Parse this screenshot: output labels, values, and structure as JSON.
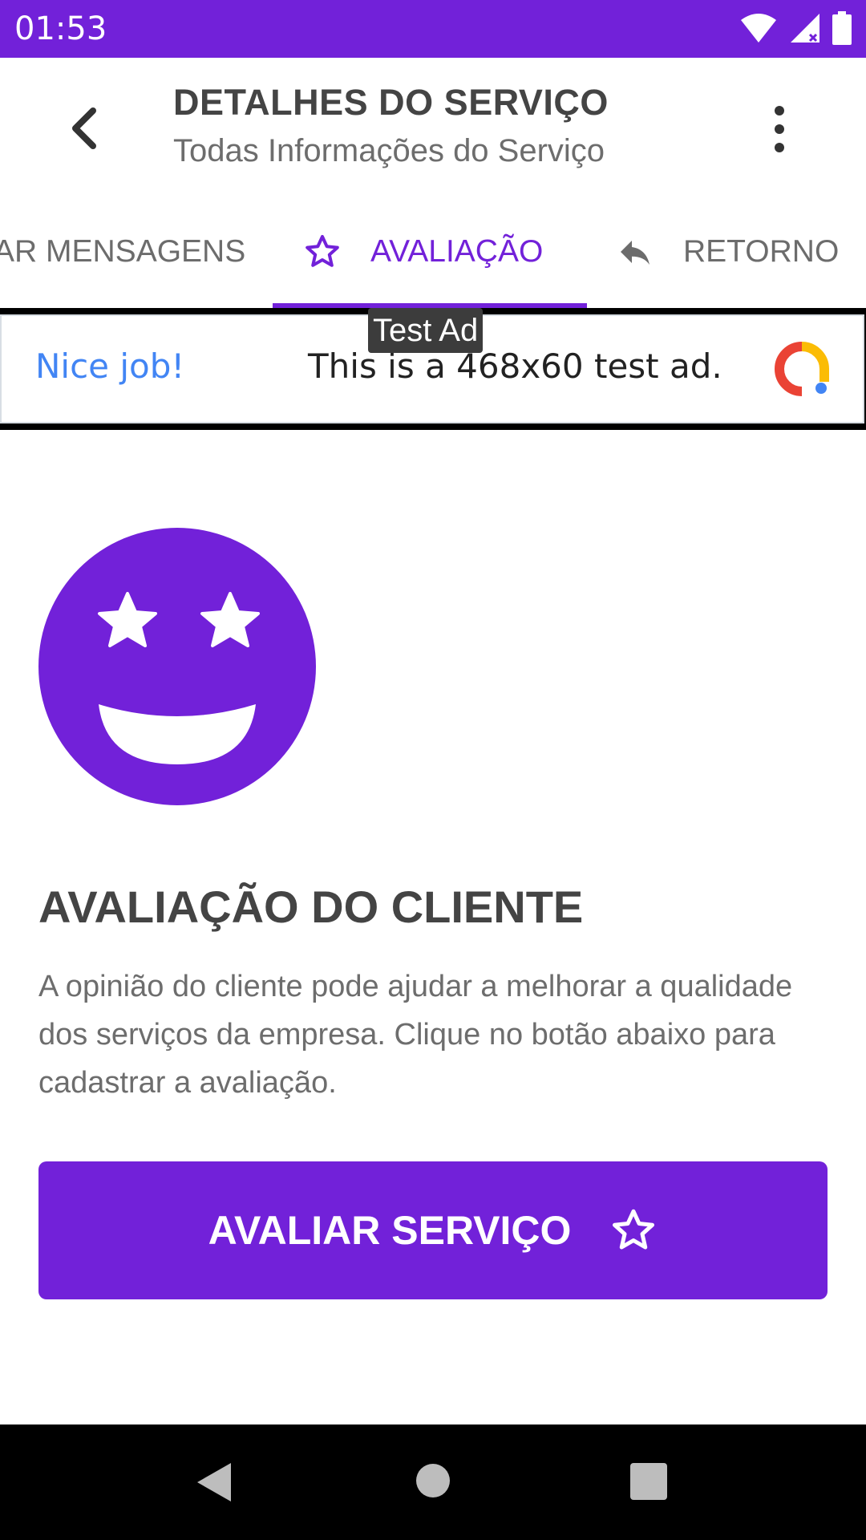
{
  "status_bar": {
    "time": "01:53",
    "icons": [
      "wifi-icon",
      "signal-icon",
      "battery-icon"
    ]
  },
  "app_bar": {
    "title": "DETALHES DO SERVIÇO",
    "subtitle": "Todas Informações do Serviço",
    "back_icon": "chevron-left-icon",
    "menu_icon": "more-vertical-icon"
  },
  "tabs": [
    {
      "label": "AR MENSAGENS",
      "icon": null,
      "selected": false
    },
    {
      "label": "AVALIAÇÃO",
      "icon": "star-outline-icon",
      "selected": true
    },
    {
      "label": "RETORNO",
      "icon": "reply-icon",
      "selected": false
    }
  ],
  "ad": {
    "label": "Test Ad",
    "headline": "Nice job!",
    "text": "This is a 468x60 test ad."
  },
  "evaluation": {
    "title": "AVALIAÇÃO DO CLIENTE",
    "description": "A opinião do cliente pode ajudar a melhorar a qualidade dos serviços da empresa. Clique no botão abaixo para cadastrar a avaliação.",
    "button_label": "AVALIAR SERVIÇO"
  },
  "colors": {
    "primary": "#7221d9",
    "text_dark": "#444444",
    "text_muted": "#6d6d6d"
  }
}
